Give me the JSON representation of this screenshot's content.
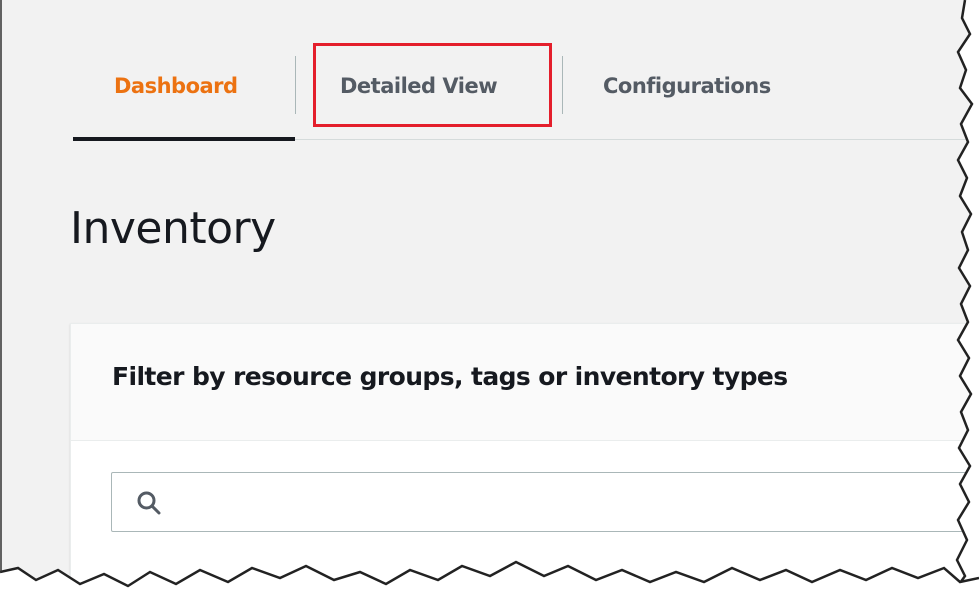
{
  "tabs": [
    {
      "label": "Dashboard",
      "active": true
    },
    {
      "label": "Detailed View",
      "active": false,
      "highlighted": true
    },
    {
      "label": "Configurations",
      "active": false
    }
  ],
  "page": {
    "title": "Inventory"
  },
  "filter_panel": {
    "title": "Filter by resource groups, tags or inventory types",
    "search": {
      "value": "",
      "placeholder": "",
      "icon": "search-icon"
    }
  },
  "colors": {
    "active_tab": "#ec7211",
    "inactive_tab": "#545b64",
    "highlight_box": "#e41e2b",
    "background": "#f2f2f2"
  }
}
